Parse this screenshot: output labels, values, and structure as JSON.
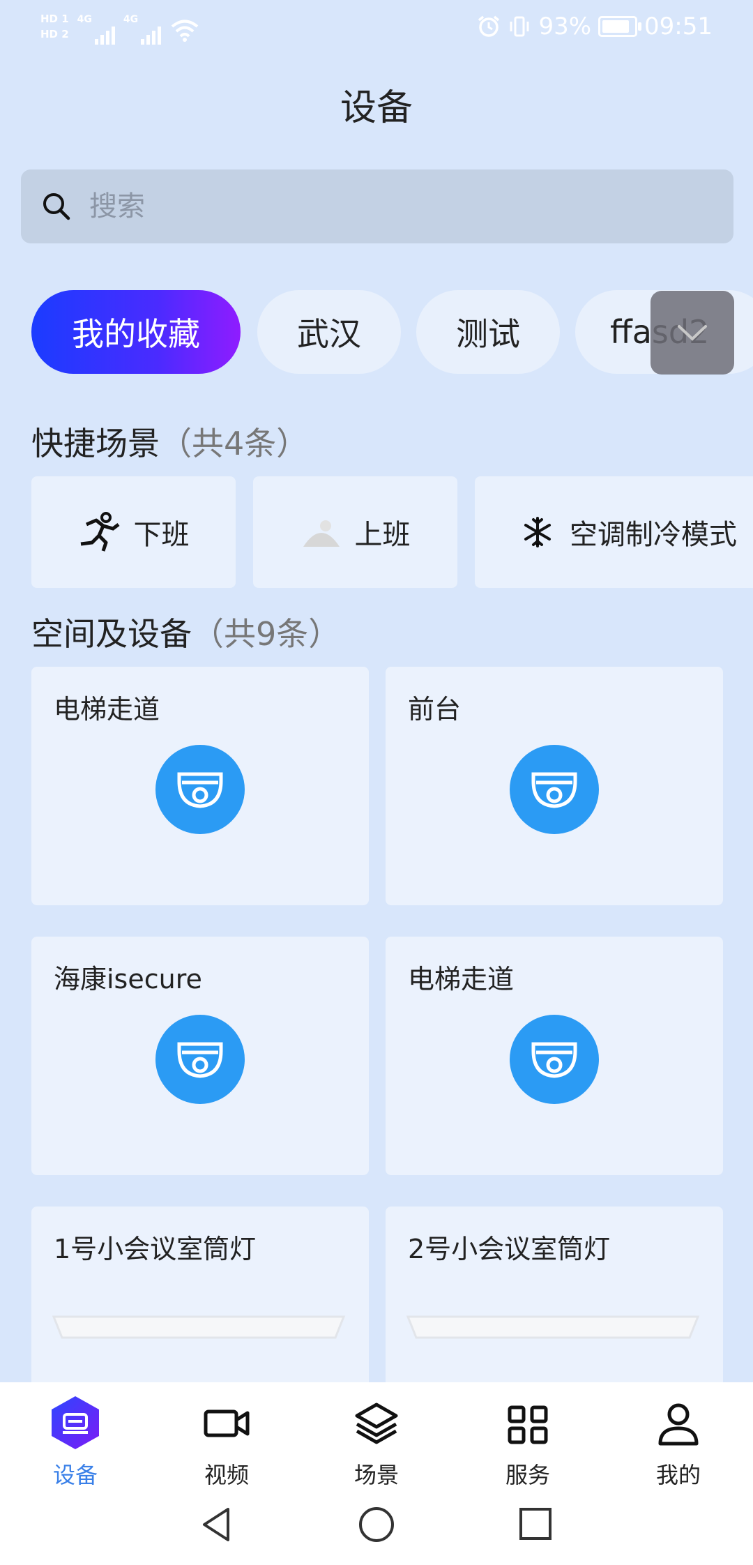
{
  "status_bar": {
    "hd1": "HD 1",
    "hd2": "HD 2",
    "net1": "4G",
    "net2": "4G",
    "battery": "93%",
    "time": "09:51"
  },
  "header": {
    "title": "设备"
  },
  "search": {
    "placeholder": "搜索"
  },
  "tabs": [
    {
      "label": "我的收藏",
      "active": true
    },
    {
      "label": "武汉"
    },
    {
      "label": "测试"
    },
    {
      "label": "ffasd2"
    }
  ],
  "quick_scenes": {
    "title": "快捷场景",
    "count": "（共4条）",
    "items": [
      {
        "label": "下班",
        "icon": "running-person-icon"
      },
      {
        "label": "上班",
        "icon": "sunrise-icon"
      },
      {
        "label": "空调制冷模式",
        "icon": "snowflake-icon"
      }
    ]
  },
  "spaces": {
    "title": "空间及设备",
    "count": "（共9条）",
    "devices": [
      {
        "name": "电梯走道",
        "icon": "camera-icon"
      },
      {
        "name": "前台",
        "icon": "camera-icon"
      },
      {
        "name": "海康isecure",
        "icon": "camera-icon"
      },
      {
        "name": "电梯走道",
        "icon": "camera-icon"
      },
      {
        "name": "1号小会议室筒灯",
        "icon": "ceiling-light-icon"
      },
      {
        "name": "2号小会议室筒灯",
        "icon": "ceiling-light-icon"
      }
    ]
  },
  "bottom_nav": [
    {
      "label": "设备",
      "active": true
    },
    {
      "label": "视频"
    },
    {
      "label": "场景"
    },
    {
      "label": "服务"
    },
    {
      "label": "我的"
    }
  ],
  "colors": {
    "accent": "#3a80e8",
    "camera": "#2b9bf4",
    "background": "#d8e6fb"
  }
}
